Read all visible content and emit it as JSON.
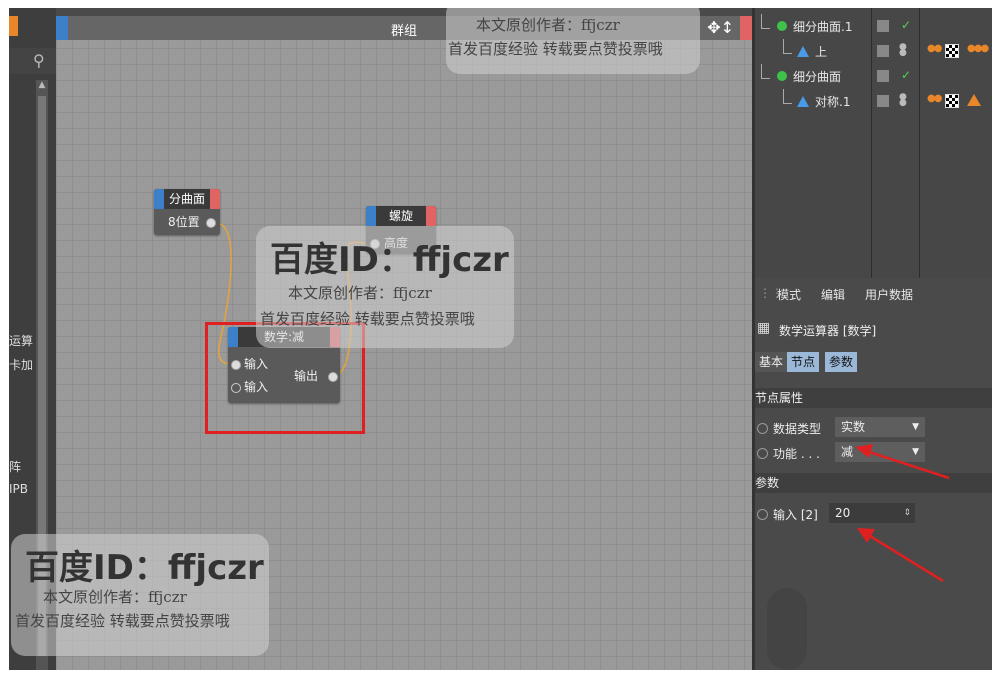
{
  "editor": {
    "title": "群组",
    "nodes": {
      "spline": {
        "title": "分曲面",
        "port": "8位置"
      },
      "helix": {
        "title": "螺旋",
        "port": "高度"
      },
      "math": {
        "title": "数学:减",
        "in1": "输入",
        "in2": "输入",
        "out": "输出"
      }
    }
  },
  "left_strip": {
    "labels": [
      "运算",
      "卡加",
      "阵",
      "IPB"
    ]
  },
  "objects": {
    "rows": [
      {
        "name": "细分曲面.1"
      },
      {
        "name": "上"
      },
      {
        "name": "细分曲面"
      },
      {
        "name": "对称.1"
      }
    ]
  },
  "attributes": {
    "menu": [
      "模式",
      "编辑",
      "用户数据"
    ],
    "title": "数学运算器 [数学]",
    "tabs": [
      "基本",
      "节点",
      "参数"
    ],
    "section_node_props": "节点属性",
    "data_type_label": "数据类型",
    "data_type_value": "实数",
    "function_label": "功能 . . .",
    "function_value": "减",
    "section_params": "参数",
    "input_label": "输入 [2]",
    "input_value": "20"
  },
  "watermark": {
    "id": "百度ID：ffjczr",
    "author": "本文原创作者：ffjczr",
    "note": "首发百度经验  转载要点赞投票哦"
  },
  "colors": {
    "highlight": "#e02020",
    "node_blue": "#3b80c8",
    "node_red": "#e06464"
  }
}
